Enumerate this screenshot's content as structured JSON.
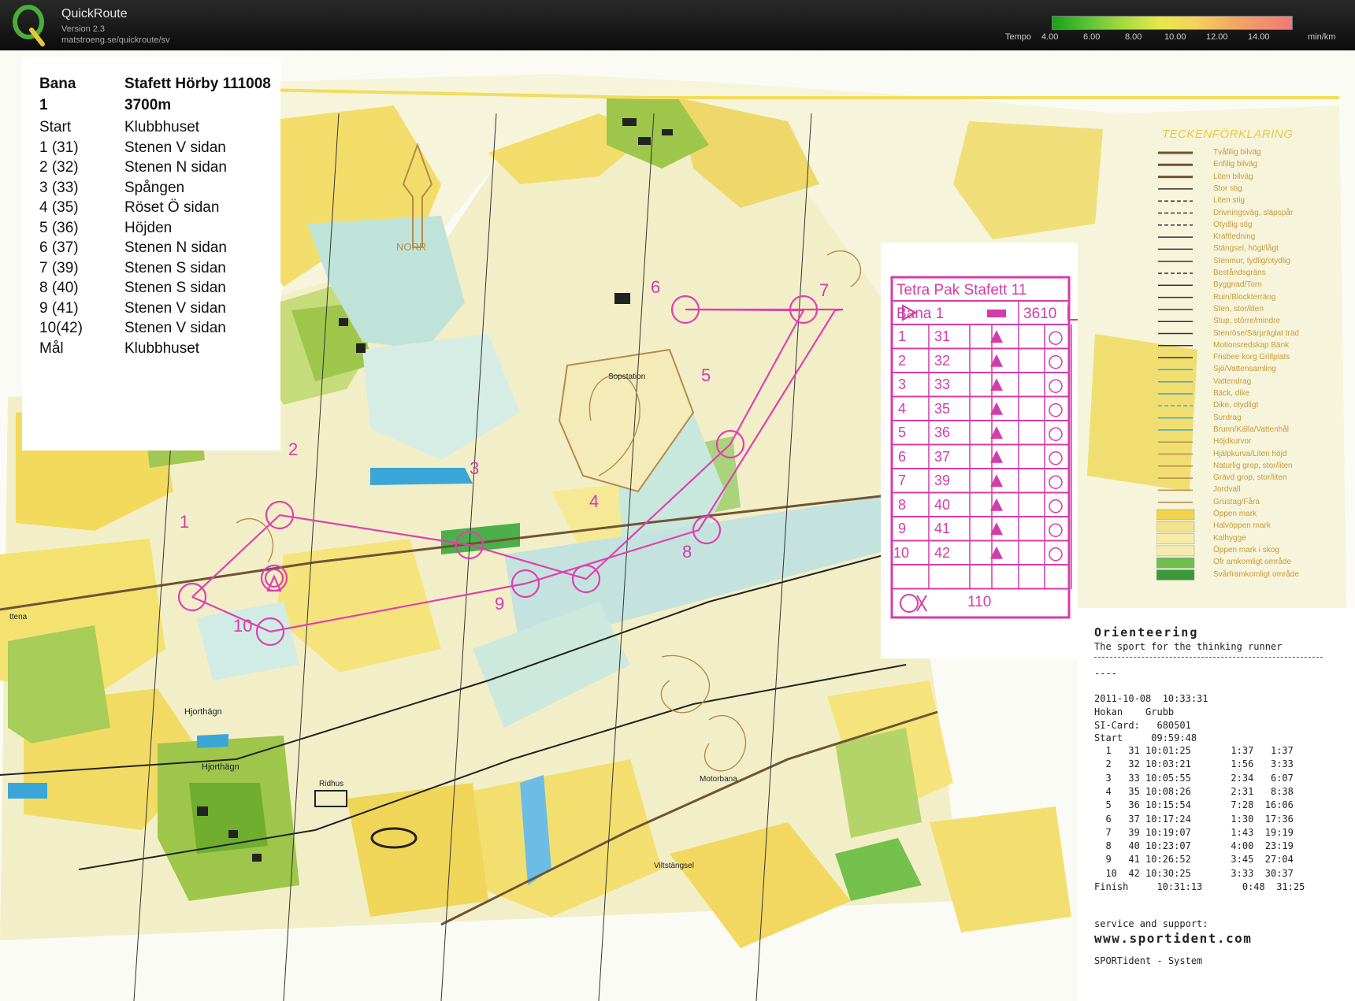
{
  "app": {
    "title": "QuickRoute",
    "version": "Version 2.3",
    "url": "matstroeng.se/quickroute/sv"
  },
  "tempo": {
    "label": "Tempo",
    "ticks": [
      "4.00",
      "6.00",
      "8.00",
      "10.00",
      "12.00",
      "14.00"
    ],
    "unit": "min/km",
    "colors": [
      "#1aa01a",
      "#a8db40",
      "#e6e84a",
      "#f2a865",
      "#ee7a78"
    ]
  },
  "course_info": {
    "header": {
      "col1": "Bana",
      "col2": "Stafett Hörby 111008"
    },
    "sub": {
      "col1": "1",
      "col2": "3700m"
    },
    "rows": [
      {
        "col1": "Start",
        "col2": "Klubbhuset"
      },
      {
        "col1": "1  (31)",
        "col2": "Stenen V sidan"
      },
      {
        "col1": "2  (32)",
        "col2": "Stenen N sidan"
      },
      {
        "col1": "3  (33)",
        "col2": "Spången"
      },
      {
        "col1": "4  (35)",
        "col2": "Röset Ö sidan"
      },
      {
        "col1": "5  (36)",
        "col2": "Höjden"
      },
      {
        "col1": "6  (37)",
        "col2": "Stenen N sidan"
      },
      {
        "col1": "7  (39)",
        "col2": "Stenen S sidan"
      },
      {
        "col1": "8  (40)",
        "col2": "Stenen S sidan"
      },
      {
        "col1": "9  (41)",
        "col2": "Stenen V sidan"
      },
      {
        "col1": "10(42)",
        "col2": "Stenen V sidan"
      },
      {
        "col1": "Mål",
        "col2": "Klubbhuset"
      }
    ]
  },
  "control_card": {
    "title": "Tetra Pak Stafett 11",
    "course": "Bana 1",
    "length": "3610",
    "rows": [
      {
        "n": "1",
        "code": "31"
      },
      {
        "n": "2",
        "code": "32"
      },
      {
        "n": "3",
        "code": "33"
      },
      {
        "n": "4",
        "code": "35"
      },
      {
        "n": "5",
        "code": "36"
      },
      {
        "n": "6",
        "code": "37"
      },
      {
        "n": "7",
        "code": "39"
      },
      {
        "n": "8",
        "code": "40"
      },
      {
        "n": "9",
        "code": "41"
      },
      {
        "n": "10",
        "code": "42"
      }
    ],
    "finish_distance": "110",
    "color": "#d43ca8"
  },
  "map": {
    "north_label": "NORR",
    "labels": [
      "Sopstation",
      "Hjorthägn",
      "Hjorthägn",
      "Ridhus",
      "Motorbana",
      "Viltstängsel",
      "ttena"
    ],
    "control_numbers": [
      "1",
      "2",
      "3",
      "4",
      "5",
      "6",
      "7",
      "8",
      "9",
      "10"
    ],
    "course_color": "#e040b0"
  },
  "legend": {
    "title": "TECKENFÖRKLARING",
    "items": [
      "Tvåfilig bilväg",
      "Enfilig bilväg",
      "Liten bilväg",
      "Stor stig",
      "Liten stig",
      "Drivningsväg, släpspår",
      "Otydlig stig",
      "Kraftledning",
      "Stängsel, högt/lågt",
      "Stenmur, tydlig/otydlig",
      "Beståndsgräns",
      "Byggnad/Torn",
      "Ruin/Blockterräng",
      "Sten, stor/liten",
      "Stup, större/mindre",
      "Stenröse/Särpräglat träd",
      "Motionsredskap   Bänk",
      "Frisbee korg   Grillplats",
      "Sjö/Vattensamling",
      "Vattendrag",
      "Bäck, dike",
      "Dike, otydligt",
      "Surdrag",
      "Brunn/Källa/Vattenhål",
      "Höjdkurvor",
      "Hjälpkurva/Liten höjd",
      "Naturlig grop, stor/liten",
      "Grävd grop, stor/liten",
      "Jordvall",
      "Grustag/Fåra",
      "Öppen mark",
      "Halvöppen mark",
      "Kalhygge",
      "Öppen mark i skog",
      "Ofr amkomligt område",
      "Svårframkomligt område"
    ]
  },
  "receipt": {
    "title": "Orienteering",
    "tagline": "The sport for the thinking runner",
    "dashes": "----",
    "datetime": "2011-10-08  10:33:31",
    "name": "Hokan    Grubb",
    "si_card": "SI-Card:   680501",
    "start": "Start     09:59:48",
    "splits": [
      "  1   31 10:01:25       1:37   1:37",
      "  2   32 10:03:21       1:56   3:33",
      "  3   33 10:05:55       2:34   6:07",
      "  4   35 10:08:26       2:31   8:38",
      "  5   36 10:15:54       7:28  16:06",
      "  6   37 10:17:24       1:30  17:36",
      "  7   39 10:19:07       1:43  19:19",
      "  8   40 10:23:07       4:00  23:19",
      "  9   41 10:26:52       3:45  27:04",
      "  10  42 10:30:25       3:33  30:37"
    ],
    "finish": "Finish     10:31:13       0:48  31:25",
    "service": "service and support:",
    "website": "www.sportident.com",
    "system": "SPORTident - System"
  }
}
